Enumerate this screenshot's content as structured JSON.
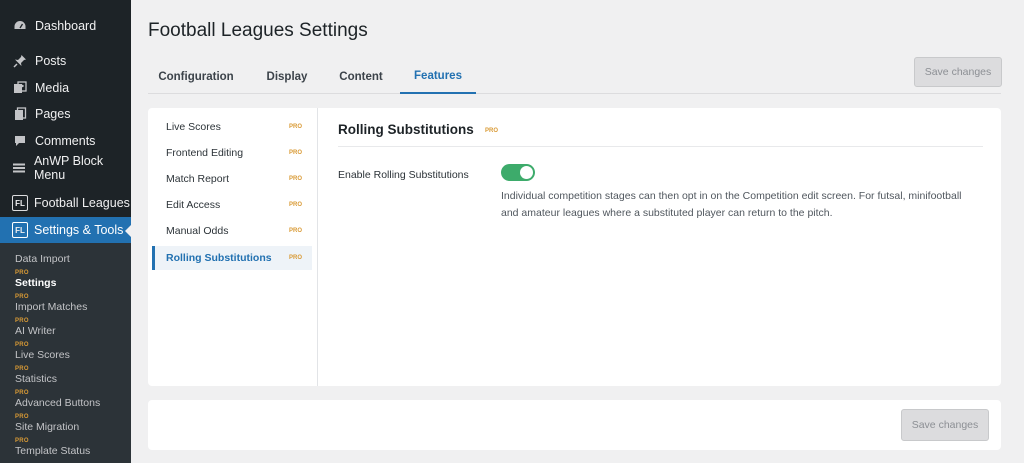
{
  "sidebar": {
    "menu": [
      {
        "label": "Dashboard",
        "icon": "dashboard-icon"
      },
      {
        "label": "Posts",
        "icon": "pin-icon"
      },
      {
        "label": "Media",
        "icon": "media-icon"
      },
      {
        "label": "Pages",
        "icon": "pages-icon"
      },
      {
        "label": "Comments",
        "icon": "comment-icon"
      },
      {
        "label": "AnWP Block Menu",
        "icon": "menu-lines-icon"
      },
      {
        "label": "Football Leagues",
        "icon": "fl-logo-icon"
      },
      {
        "label": "Settings & Tools",
        "icon": "fl-logo-icon"
      }
    ],
    "fl_badge": "FL",
    "submenu": [
      {
        "label": "Data Import",
        "pro": ""
      },
      {
        "label": "Settings",
        "pro": "PRO"
      },
      {
        "label": "Import Matches",
        "pro": "PRO"
      },
      {
        "label": "AI Writer",
        "pro": "PRO"
      },
      {
        "label": "Live Scores",
        "pro": "PRO"
      },
      {
        "label": "Statistics",
        "pro": "PRO"
      },
      {
        "label": "Advanced Buttons",
        "pro": "PRO"
      },
      {
        "label": "Site Migration",
        "pro": "PRO"
      },
      {
        "label": "Template Status",
        "pro": "PRO"
      }
    ]
  },
  "page": {
    "title": "Football Leagues Settings",
    "tabs": [
      "Configuration",
      "Display",
      "Content",
      "Features"
    ],
    "active_tab": "Features",
    "save_label": "Save changes"
  },
  "features_nav": [
    {
      "label": "Live Scores",
      "pro": "PRO"
    },
    {
      "label": "Frontend Editing",
      "pro": "PRO"
    },
    {
      "label": "Match Report",
      "pro": "PRO"
    },
    {
      "label": "Edit Access",
      "pro": "PRO"
    },
    {
      "label": "Manual Odds",
      "pro": "PRO"
    },
    {
      "label": "Rolling Substitutions",
      "pro": "PRO"
    }
  ],
  "content": {
    "title": "Rolling Substitutions",
    "pro": "PRO",
    "field_label": "Enable Rolling Substitutions",
    "toggle_on": true,
    "description": "Individual competition stages can then opt in on the Competition edit screen. For futsal, minifootball and amateur leagues where a substituted player can return to the pitch."
  },
  "colors": {
    "accent": "#2271b1",
    "toggle_on": "#3dab6b",
    "pro_tag": "#d99a35",
    "sidebar_bg": "#1d2327"
  }
}
